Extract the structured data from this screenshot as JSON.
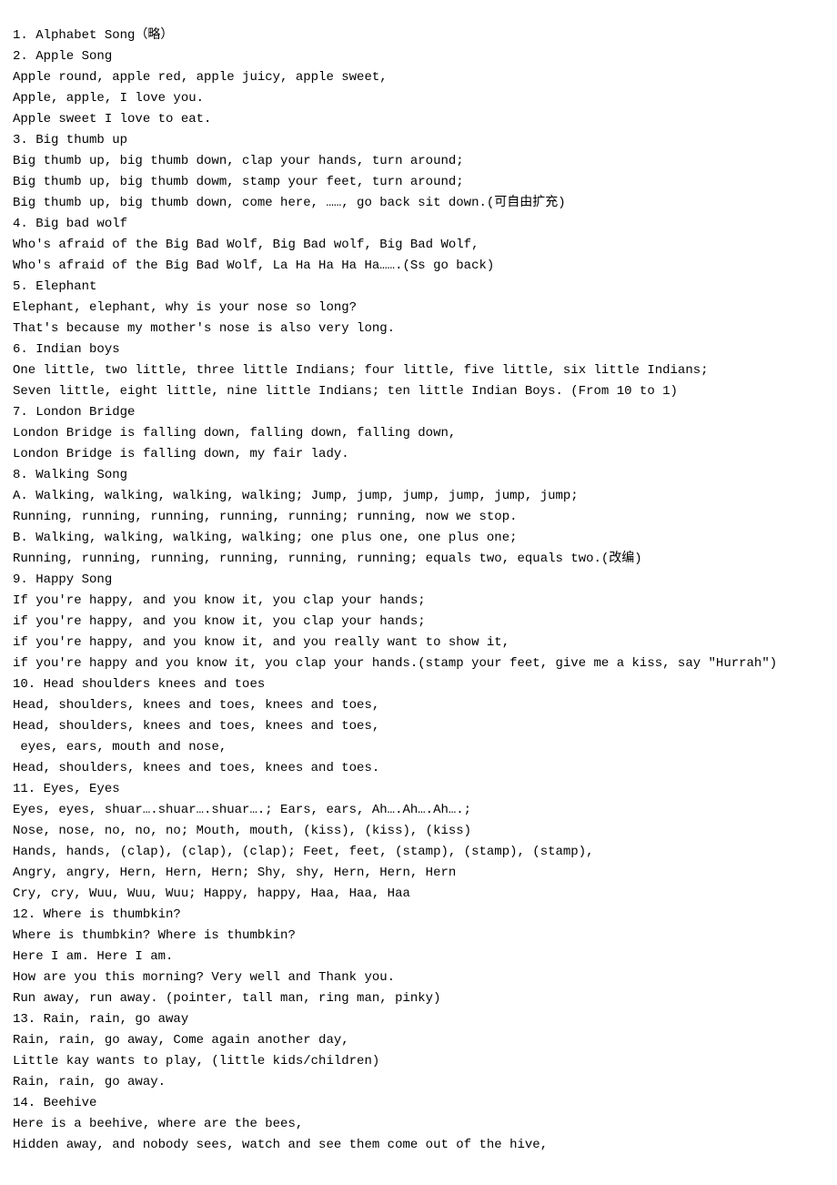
{
  "lines": [
    "1. Alphabet Song（略）",
    "2. Apple Song",
    "Apple round, apple red, apple juicy, apple sweet,",
    "Apple, apple, I love you.",
    "Apple sweet I love to eat.",
    "3. Big thumb up",
    "Big thumb up, big thumb down, clap your hands, turn around;",
    "Big thumb up, big thumb dowm, stamp your feet, turn around;",
    "Big thumb up, big thumb down, come here, ……, go back sit down.(可自由扩充)",
    "4. Big bad wolf",
    "Who's afraid of the Big Bad Wolf, Big Bad wolf, Big Bad Wolf,",
    "Who's afraid of the Big Bad Wolf, La Ha Ha Ha Ha…….(Ss go back)",
    "5. Elephant",
    "Elephant, elephant, why is your nose so long?",
    "That's because my mother's nose is also very long.",
    "6. Indian boys",
    "One little, two little, three little Indians; four little, five little, six little Indians;",
    "Seven little, eight little, nine little Indians; ten little Indian Boys. (From 10 to 1)",
    "7. London Bridge",
    "London Bridge is falling down, falling down, falling down,",
    "London Bridge is falling down, my fair lady.",
    "8. Walking Song",
    "A. Walking, walking, walking, walking; Jump, jump, jump, jump, jump, jump;",
    "Running, running, running, running, running; running, now we stop.",
    "B. Walking, walking, walking, walking; one plus one, one plus one;",
    "Running, running, running, running, running, running; equals two, equals two.(改编)",
    "9. Happy Song",
    "If you're happy, and you know it, you clap your hands;",
    "if you're happy, and you know it, you clap your hands;",
    "if you're happy, and you know it, and you really want to show it,",
    "if you're happy and you know it, you clap your hands.(stamp your feet, give me a kiss, say \"Hurrah\")",
    "10. Head shoulders knees and toes",
    "Head, shoulders, knees and toes, knees and toes,",
    "Head, shoulders, knees and toes, knees and toes,",
    " eyes, ears, mouth and nose,",
    "Head, shoulders, knees and toes, knees and toes.",
    "11. Eyes, Eyes",
    "Eyes, eyes, shuar….shuar….shuar….; Ears, ears, Ah….Ah….Ah….;",
    "Nose, nose, no, no, no; Mouth, mouth, (kiss), (kiss), (kiss)",
    "Hands, hands, (clap), (clap), (clap); Feet, feet, (stamp), (stamp), (stamp),",
    "Angry, angry, Hern, Hern, Hern; Shy, shy, Hern, Hern, Hern",
    "Cry, cry, Wuu, Wuu, Wuu; Happy, happy, Haa, Haa, Haa",
    "12. Where is thumbkin?",
    "Where is thumbkin? Where is thumbkin?",
    "Here I am. Here I am.",
    "How are you this morning? Very well and Thank you.",
    "Run away, run away. (pointer, tall man, ring man, pinky)",
    "13. Rain, rain, go away",
    "Rain, rain, go away, Come again another day,",
    "Little kay wants to play, (little kids/children)",
    "Rain, rain, go away.",
    "14. Beehive",
    "Here is a beehive, where are the bees,",
    "Hidden away, and nobody sees, watch and see them come out of the hive,"
  ]
}
